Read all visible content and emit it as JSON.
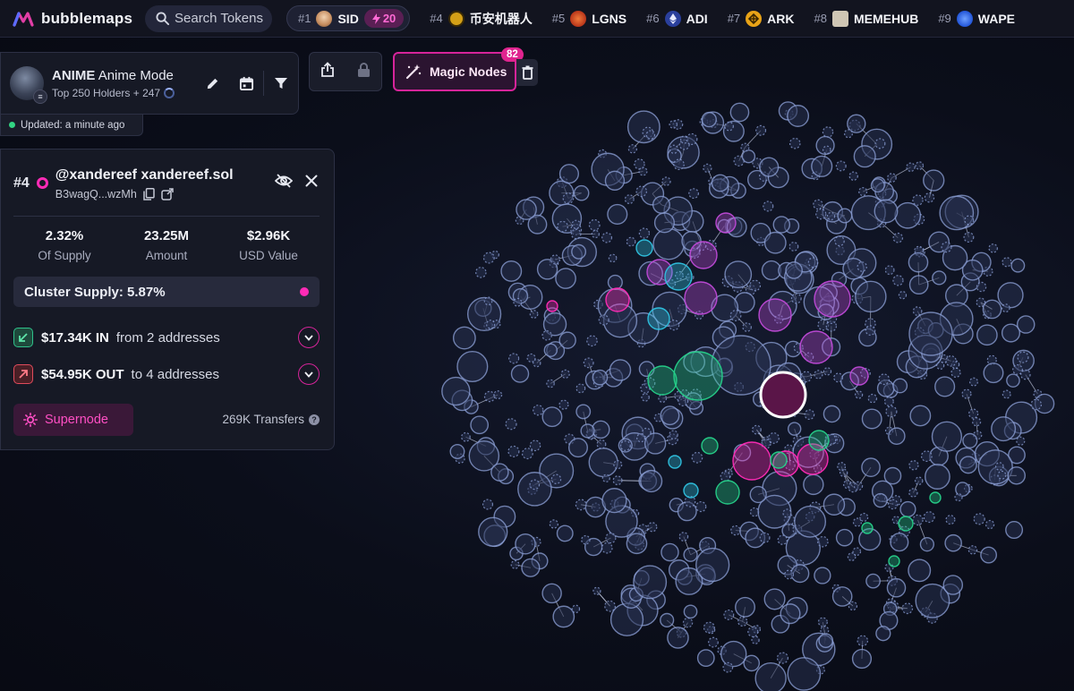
{
  "app": {
    "logo_text": "bubblemaps"
  },
  "search": {
    "placeholder": "Search Tokens"
  },
  "ticker": [
    {
      "rank": "#1",
      "name": "SID",
      "boost": "20",
      "icon_color": "#d9b38c"
    },
    {
      "rank": "#4",
      "name": "币安机器人",
      "icon_color": "#d4a017"
    },
    {
      "rank": "#5",
      "name": "LGNS",
      "icon_color": "#e0542a"
    },
    {
      "rank": "#6",
      "name": "ADI",
      "icon_color": "#3b5bdb"
    },
    {
      "rank": "#7",
      "name": "ARK",
      "icon_color": "#e8a317"
    },
    {
      "rank": "#8",
      "name": "MEMEHUB",
      "icon_color": "#444444"
    },
    {
      "rank": "#9",
      "name": "WAPE",
      "icon_color": "#2f6ee8"
    }
  ],
  "map": {
    "symbol": "ANIME",
    "name": "Anime Mode",
    "subtitle": "Top 250 Holders + 247",
    "updated": "Updated: a minute ago"
  },
  "magic_nodes": {
    "label": "Magic Nodes",
    "count": "82"
  },
  "wallet": {
    "rank": "#4",
    "name": "@xandereef xandereef.sol",
    "address": "B3wagQ...wzMh",
    "stats": [
      {
        "value": "2.32%",
        "label": "Of Supply"
      },
      {
        "value": "23.25M",
        "label": "Amount"
      },
      {
        "value": "$2.96K",
        "label": "USD Value"
      }
    ],
    "cluster_supply": "Cluster Supply: 5.87%",
    "inflow": {
      "amount": "$17.34K IN",
      "text": "from 2 addresses"
    },
    "outflow": {
      "amount": "$54.95K OUT",
      "text": "to 4 addresses"
    },
    "supernode_label": "Supernode",
    "transfers": "269K Transfers"
  },
  "colors": {
    "accent": "#d6249a",
    "node": "#8fa3d9",
    "magenta": "#ff2bb6",
    "purple": "#c04ad8",
    "cyan": "#2fc2e0",
    "green": "#26d18a"
  }
}
